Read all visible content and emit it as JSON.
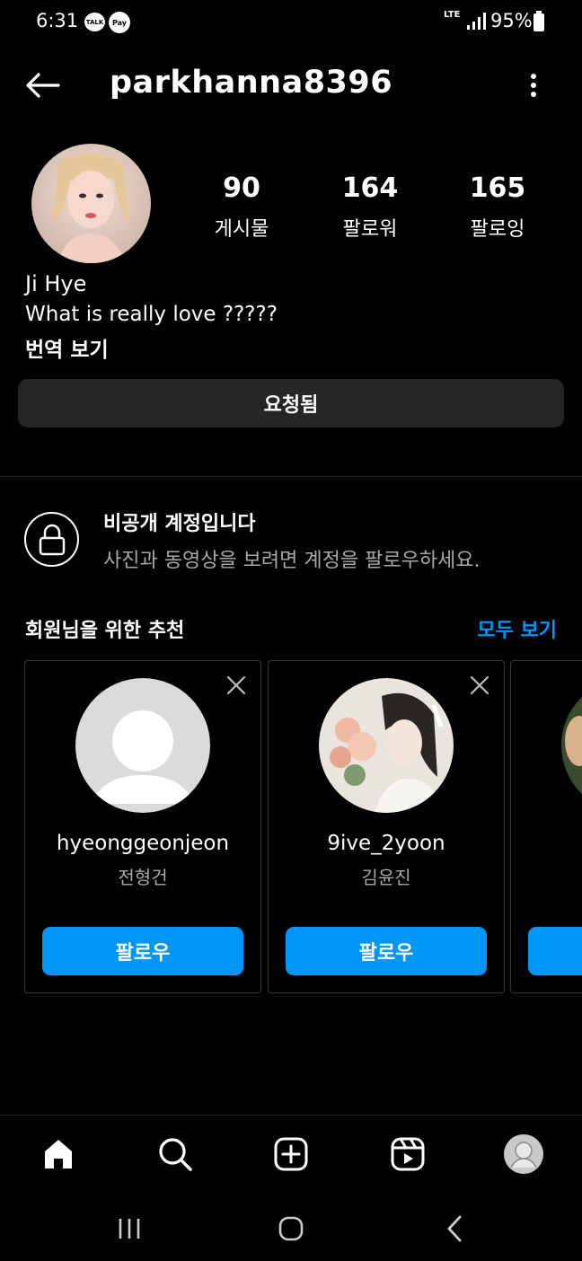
{
  "status_bar": {
    "time": "6:31",
    "notification_icons": [
      "talk-icon",
      "pay-icon"
    ],
    "talk_label": "TALK",
    "pay_label": "Pay",
    "network": "LTE",
    "battery": "95%"
  },
  "header": {
    "username": "parkhanna8396",
    "back_icon": "back-arrow-icon",
    "more_icon": "more-vertical-icon"
  },
  "profile": {
    "stats": [
      {
        "value": "90",
        "label": "게시물"
      },
      {
        "value": "164",
        "label": "팔로워"
      },
      {
        "value": "165",
        "label": "팔로잉"
      }
    ],
    "name": "Ji Hye",
    "bio": "What is really love ?????",
    "translate_label": "번역 보기",
    "requested_label": "요청됨"
  },
  "private_notice": {
    "title": "비공개 계정입니다",
    "description": "사진과 동영상을 보려면 계정을 팔로우하세요."
  },
  "suggestions": {
    "title": "회원님을 위한 추천",
    "see_all_label": "모두 보기",
    "cards": [
      {
        "username": "hyeonggeonjeon",
        "full_name": "전형건",
        "follow_label": "팔로우"
      },
      {
        "username": "9ive_2yoon",
        "full_name": "김윤진",
        "follow_label": "팔로우"
      }
    ]
  },
  "bottom_nav": [
    "home-icon",
    "search-icon",
    "create-icon",
    "reels-icon",
    "profile-avatar"
  ],
  "system_nav": [
    "recents-icon",
    "home-circle-icon",
    "back-chevron-icon"
  ],
  "colors": {
    "background": "#000000",
    "accent": "#0095f6",
    "button_gray": "#262626",
    "secondary_text": "#a8a8a8"
  }
}
